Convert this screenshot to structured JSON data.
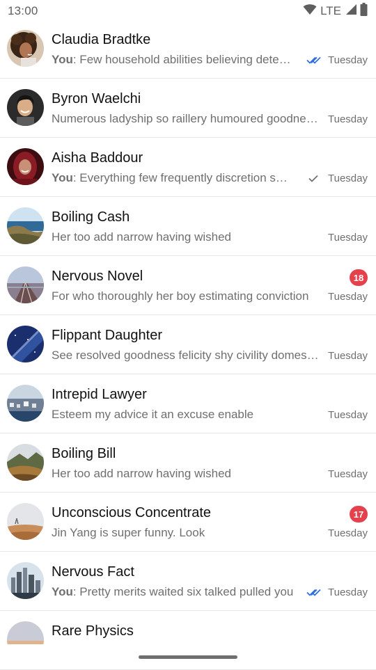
{
  "status_bar": {
    "time": "13:00",
    "network": "LTE",
    "icons": [
      "wifi-icon",
      "signal-icon",
      "battery-icon"
    ]
  },
  "conversations": [
    {
      "name": "Claudia Bradtke",
      "you_prefix": "You",
      "preview": ": Few household abilities believing determine zealously",
      "date": "Tuesday",
      "status": "read",
      "unread": null,
      "avatar": "person-curly-hair"
    },
    {
      "name": "Byron Waelchi",
      "you_prefix": "",
      "preview": "Numerous ladyship so raillery humoured goodness received an",
      "date": "Tuesday",
      "status": "none",
      "unread": null,
      "avatar": "person-smiling"
    },
    {
      "name": "Aisha Baddour",
      "you_prefix": "You",
      "preview": ": Everything few frequently discretion surrounded did simplicity",
      "date": "Tuesday",
      "status": "sent",
      "unread": null,
      "avatar": "person-hijab"
    },
    {
      "name": "Boiling Cash",
      "you_prefix": "",
      "preview": "Her too add narrow having wished",
      "date": "Tuesday",
      "status": "none",
      "unread": null,
      "avatar": "coast-landscape"
    },
    {
      "name": "Nervous Novel",
      "you_prefix": "",
      "preview": "For who thoroughly her boy estimating conviction",
      "date": "Tuesday",
      "status": "none",
      "unread": "18",
      "avatar": "railway-landscape"
    },
    {
      "name": "Flippant Daughter",
      "you_prefix": "",
      "preview": "See resolved goodness felicity shy civility domestic had but",
      "date": "Tuesday",
      "status": "none",
      "unread": null,
      "avatar": "night-sky"
    },
    {
      "name": "Intrepid Lawyer",
      "you_prefix": "",
      "preview": "Esteem my advice it an excuse enable",
      "date": "Tuesday",
      "status": "none",
      "unread": null,
      "avatar": "city-coast"
    },
    {
      "name": "Boiling Bill",
      "you_prefix": "",
      "preview": "Her too add narrow having wished",
      "date": "Tuesday",
      "status": "none",
      "unread": null,
      "avatar": "mountain-sunset"
    },
    {
      "name": "Unconscious Concentrate",
      "you_prefix": "",
      "preview": "Jin Yang is super funny. Look",
      "date": "Tuesday",
      "status": "none",
      "unread": "17",
      "avatar": "field-landscape"
    },
    {
      "name": "Nervous Fact",
      "you_prefix": "You",
      "preview": ": Pretty merits waited six talked pulled you",
      "date": "Tuesday",
      "status": "read",
      "unread": null,
      "avatar": "city-skyline"
    },
    {
      "name": "Rare Physics",
      "you_prefix": "",
      "preview": "",
      "date": "",
      "status": "none",
      "unread": null,
      "avatar": "dusk-horizon"
    }
  ],
  "colors": {
    "read_tick": "#2f6fe0",
    "sent_tick": "#707070",
    "badge": "#e5414c",
    "divider": "#e6e6e6"
  }
}
